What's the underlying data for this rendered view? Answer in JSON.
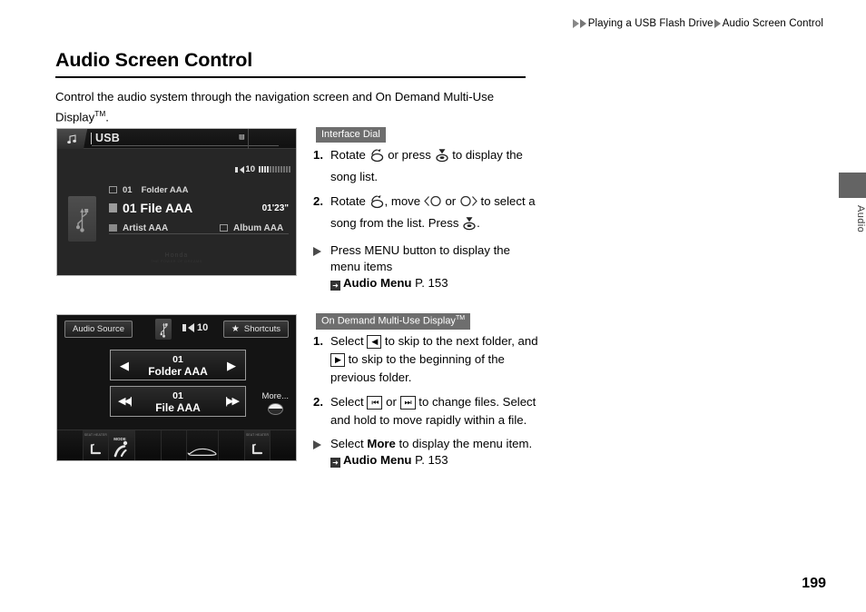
{
  "breadcrumb": {
    "parent": "Playing a USB Flash Drive",
    "current": "Audio Screen Control"
  },
  "page_title": "Audio Screen Control",
  "intro": {
    "text_before": "Control the audio system through the navigation screen and On Demand Multi-Use Display",
    "tm": "TM",
    "text_after": "."
  },
  "side_tab": {
    "label": "Audio"
  },
  "page_number": "199",
  "nav_screen": {
    "tab_icon": "music-note-icon",
    "source_label": "USB",
    "clock": "",
    "volume_value": "10",
    "volume_level": 4,
    "volume_total": 12,
    "device_icon": "usb-icon",
    "folder_number": "01",
    "folder_name": "Folder AAA",
    "file_number_name": "01 File AAA",
    "duration": "01'23\"",
    "artist": "Artist AAA",
    "album": "Album AAA",
    "watermark": "Honda",
    "watermark_sub": "THE POWER OF DREAMS"
  },
  "odmd_screen": {
    "audio_source_label": "Audio Source",
    "usb_icon": "usb-icon",
    "volume_value": "10",
    "shortcuts_label": "Shortcuts",
    "shortcuts_icon": "star-icon",
    "folder_number": "01",
    "folder_name": "Folder AAA",
    "file_number": "01",
    "file_name": "File AAA",
    "prev_folder_icon": "triangle-left-icon",
    "next_folder_icon": "triangle-right-icon",
    "prev_track_icon": "skip-back-icon",
    "next_track_icon": "skip-forward-icon",
    "more_label": "More...",
    "bottom_bar": {
      "left_seat_label": "SEAT HEATER",
      "mode_label": "MODE",
      "right_seat_label": "SEAT HEATER",
      "icons": [
        "seat-heater-icon",
        "fan-mode-icon",
        "blank",
        "blank",
        "car-defrost-icon",
        "blank",
        "seat-heater-icon",
        "blank"
      ]
    }
  },
  "interface_dial": {
    "heading": "Interface Dial",
    "steps": [
      {
        "number": "1.",
        "part1": "Rotate",
        "icon1": "rotary-dial-icon",
        "part2": "or press",
        "icon2": "press-dial-icon",
        "part3": "to display the song list."
      },
      {
        "number": "2.",
        "part1": "Rotate",
        "icon1": "rotary-dial-icon",
        "part2": ", move",
        "icon2": "dial-left-icon",
        "part3": "or",
        "icon3": "dial-right-icon",
        "part4": "to select a song from the list. Press",
        "icon4": "press-dial-icon",
        "part5": "."
      }
    ],
    "sub": {
      "text": "Press MENU button to display the menu items",
      "ref_icon": "arrow-ref-icon",
      "ref_label": "Audio Menu",
      "ref_page": "P. 153"
    }
  },
  "odmd_section": {
    "heading": "On Demand Multi-Use Display",
    "heading_tm": "TM",
    "steps": [
      {
        "number": "1.",
        "part1": "Select",
        "key1": "◀",
        "part2": "to skip to the next folder, and",
        "key2": "▶",
        "part3": "to skip to the beginning of the previous folder."
      },
      {
        "number": "2.",
        "part1": "Select",
        "key1": "⏮",
        "part2": "or",
        "key2": "⏭",
        "part3": "to change files. Select and hold to move rapidly within a file."
      }
    ],
    "sub": {
      "text_before": "Select",
      "bold": "More",
      "text_after": "to display the menu item.",
      "ref_icon": "arrow-ref-icon",
      "ref_label": "Audio Menu",
      "ref_page": "P. 153"
    }
  }
}
